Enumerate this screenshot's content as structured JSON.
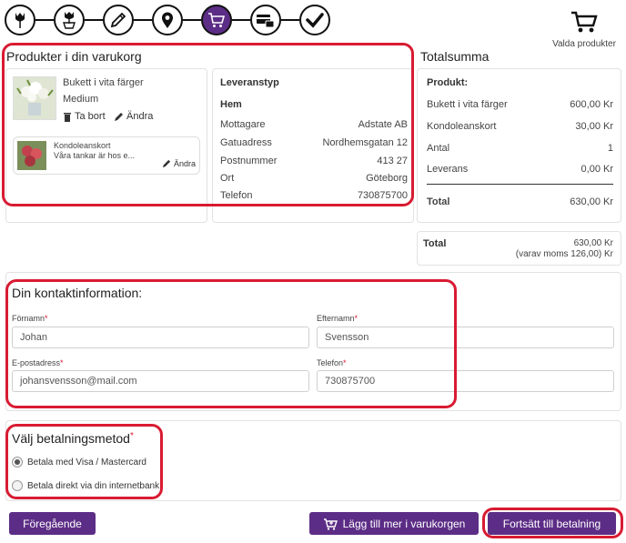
{
  "steps": [
    {
      "icon": "tulip-icon"
    },
    {
      "icon": "tulip-basket-icon"
    },
    {
      "icon": "pencil-icon"
    },
    {
      "icon": "map-pin-icon"
    },
    {
      "icon": "cart-icon",
      "active": true
    },
    {
      "icon": "payment-icon"
    },
    {
      "icon": "checkmark-icon"
    }
  ],
  "cart_top": {
    "label": "Valda produkter"
  },
  "products": {
    "title": "Produkter i din varukorg",
    "item_name": "Bukett i vita färger",
    "item_size": "Medium",
    "remove_label": "Ta bort",
    "edit_label": "Ändra",
    "card_name": "Kondoleanskort",
    "card_text": "Våra tankar är hos e...",
    "card_edit_label": "Ändra"
  },
  "delivery": {
    "title": "Leveranstyp",
    "type": "Hem",
    "rows": [
      {
        "label": "Mottagare",
        "value": "Adstate AB"
      },
      {
        "label": "Gatuadress",
        "value": "Nordhemsgatan 12"
      },
      {
        "label": "Postnummer",
        "value": "413 27"
      },
      {
        "label": "Ort",
        "value": "Göteborg"
      },
      {
        "label": "Telefon",
        "value": "730875700"
      }
    ]
  },
  "summary": {
    "title": "Totalsumma",
    "product_heading": "Produkt:",
    "rows": [
      {
        "label": "Bukett i vita färger",
        "value": "600,00 Kr"
      },
      {
        "label": "Kondoleanskort",
        "value": "30,00 Kr"
      },
      {
        "label": "Antal",
        "value": "1"
      },
      {
        "label": "Leverans",
        "value": "0,00 Kr"
      }
    ],
    "total_label": "Total",
    "total_value": "630,00 Kr",
    "grand_label": "Total",
    "grand_value": "630,00 Kr",
    "vat_note": "(varav moms 126,00) Kr"
  },
  "contact": {
    "title": "Din kontaktinformation:",
    "firstname_label": "Förnamn",
    "firstname_value": "Johan",
    "lastname_label": "Efternamn",
    "lastname_value": "Svensson",
    "email_label": "E-postadress",
    "email_value": "johansvensson@mail.com",
    "phone_label": "Telefon",
    "phone_value": "730875700",
    "required_mark": "*"
  },
  "payment": {
    "title": "Välj betalningsmetod",
    "required_mark": "*",
    "option_card": "Betala med Visa / Mastercard",
    "option_bank": "Betala direkt via din internetbank"
  },
  "buttons": {
    "previous": "Föregående",
    "add_more": "Lägg till mer i varukorgen",
    "continue": "Fortsätt till betalning"
  },
  "colors": {
    "accent": "#5c2d86",
    "highlight": "#d81b32"
  }
}
